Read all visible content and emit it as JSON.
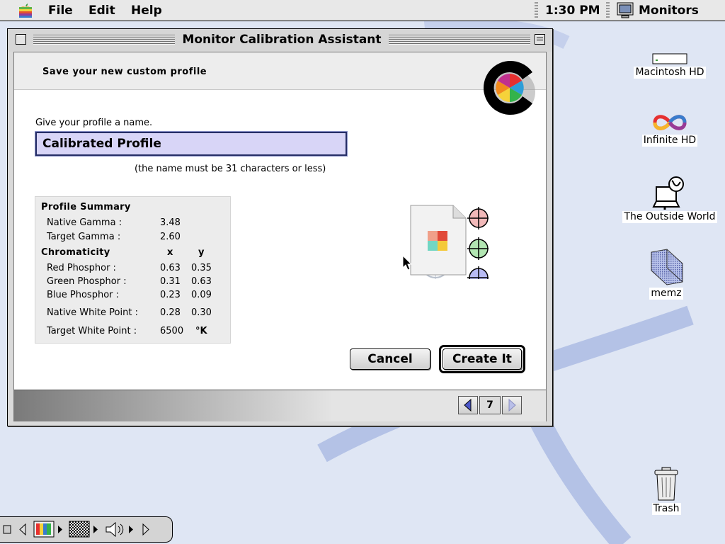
{
  "menubar": {
    "items": [
      "File",
      "Edit",
      "Help"
    ],
    "clock": "1:30 PM",
    "active_app": "Monitors"
  },
  "window": {
    "title": "Monitor Calibration Assistant",
    "step_title": "Save your new custom profile",
    "name_prompt": "Give your profile a name.",
    "profile_name": "Calibrated Profile",
    "name_hint": "(the name must be 31 characters or less)",
    "summary": {
      "heading": "Profile Summary",
      "native_gamma_label": "Native Gamma :",
      "native_gamma": "3.48",
      "target_gamma_label": "Target Gamma :",
      "target_gamma": "2.60",
      "chromaticity_heading": "Chromaticity",
      "x_header": "x",
      "y_header": "y",
      "red_label": "Red Phosphor :",
      "red_x": "0.63",
      "red_y": "0.35",
      "green_label": "Green Phosphor :",
      "green_x": "0.31",
      "green_y": "0.63",
      "blue_label": "Blue Phosphor :",
      "blue_x": "0.23",
      "blue_y": "0.09",
      "native_white_label": "Native White Point :",
      "native_white_x": "0.28",
      "native_white_y": "0.30",
      "target_white_label": "Target White Point :",
      "target_white_value": "6500",
      "target_white_unit": "°K"
    },
    "buttons": {
      "cancel": "Cancel",
      "create": "Create It"
    },
    "pager": {
      "page": "7"
    }
  },
  "desktop": {
    "icons": [
      "Macintosh HD",
      "Infinite HD",
      "The Outside World",
      "memz",
      "Trash"
    ]
  },
  "colors": {
    "desktop": "#dfe6f4",
    "desktop_swoosh": "#b4c2e6",
    "name_field_bg": "#d8d5f7",
    "name_field_border": "#262e66"
  }
}
